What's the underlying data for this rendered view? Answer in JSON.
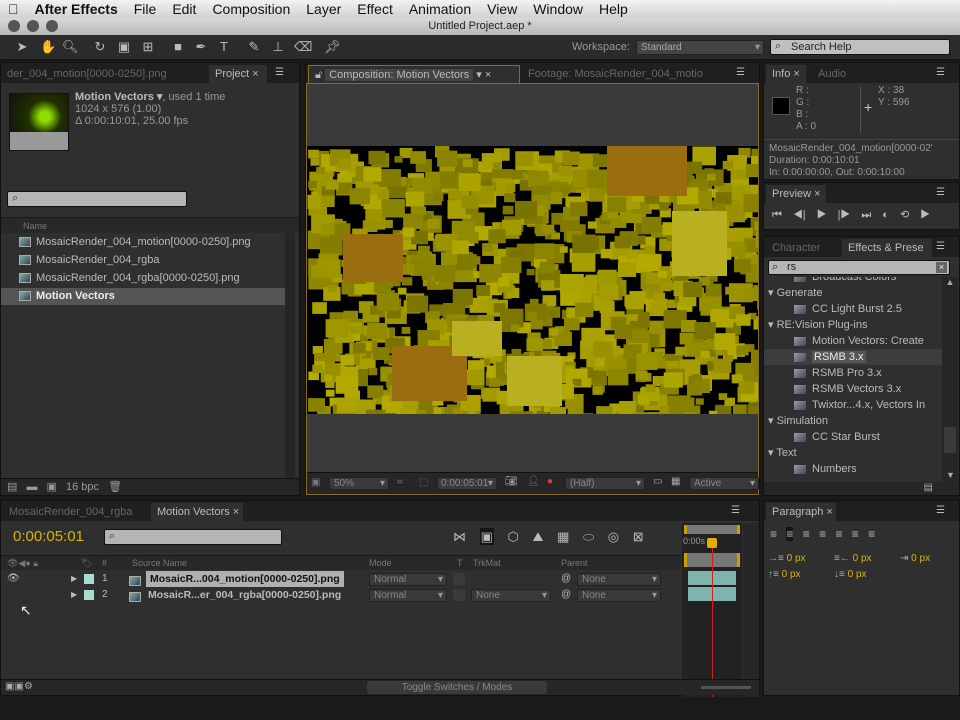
{
  "menubar": {
    "apple": "",
    "app": "After Effects",
    "items": [
      "File",
      "Edit",
      "Composition",
      "Layer",
      "Effect",
      "Animation",
      "View",
      "Window",
      "Help"
    ]
  },
  "window_title": "Untitled Project.aep *",
  "toolbar": {
    "workspace_label": "Workspace:",
    "workspace_value": "Standard",
    "search_help_placeholder": "Search Help"
  },
  "project": {
    "tabs": [
      "der_004_motion[0000-0250].png",
      "Project"
    ],
    "selected_name": "Motion Vectors ▾",
    "used": ", used 1 time",
    "dimensions": "1024 x 576 (1.00)",
    "duration": "Δ 0:00:10:01, 25.00 fps",
    "column_name": "Name",
    "items": [
      {
        "name": "MosaicRender_004_motion[0000-0250].png",
        "type": "footage"
      },
      {
        "name": "MosaicRender_004_rgba",
        "type": "comp"
      },
      {
        "name": "MosaicRender_004_rgba[0000-0250].png",
        "type": "footage"
      },
      {
        "name": "Motion Vectors",
        "type": "comp",
        "selected": true
      }
    ],
    "bpc": "16 bpc"
  },
  "composition": {
    "tabs": [
      "Composition: Motion Vectors",
      "Footage: MosaicRender_004_motio"
    ],
    "zoom": "50%",
    "timecode": "0:00:05:01",
    "resolution": "(Half)",
    "camera": "Active Camera"
  },
  "info": {
    "tabs": [
      "Info",
      "Audio"
    ],
    "r": "R :",
    "g": "G :",
    "b": "B :",
    "a": "A : 0",
    "x": "X : 38",
    "y": "Y : 596",
    "source": "MosaicRender_004_motion[0000-02'",
    "duration": "Duration: 0:00:10:01",
    "inout": "In: 0:00:00:00, Out: 0:00:10:00"
  },
  "preview": {
    "tab": "Preview"
  },
  "effects": {
    "tabs": [
      "Character",
      "Effects & Prese"
    ],
    "search": "rs",
    "items": [
      {
        "label": "Broadcast Colors",
        "level": 1
      },
      {
        "label": "Generate",
        "level": 0
      },
      {
        "label": "CC Light Burst 2.5",
        "level": 1
      },
      {
        "label": "RE:Vision Plug-ins",
        "level": 0
      },
      {
        "label": "Motion Vectors: Create",
        "level": 1
      },
      {
        "label": "RSMB 3.x",
        "level": 1,
        "selected": true
      },
      {
        "label": "RSMB Pro 3.x",
        "level": 1
      },
      {
        "label": "RSMB Vectors 3.x",
        "level": 1
      },
      {
        "label": "Twixtor...4.x, Vectors In",
        "level": 1
      },
      {
        "label": "Simulation",
        "level": 0
      },
      {
        "label": "CC Star Burst",
        "level": 1
      },
      {
        "label": "Text",
        "level": 0
      },
      {
        "label": "Numbers",
        "level": 1
      }
    ]
  },
  "timeline": {
    "tabs": [
      "MosaicRender_004_rgba",
      "Motion Vectors"
    ],
    "timecode": "0:00:05:01",
    "columns": {
      "num": "#",
      "source": "Source Name",
      "mode": "Mode",
      "t": "T",
      "trkmat": "TrkMat",
      "parent": "Parent"
    },
    "ruler_label": "0:00s",
    "layers": [
      {
        "num": "1",
        "name": "MosaicR...004_motion[0000-0250].png",
        "mode": "Normal",
        "trkmat": "",
        "parent": "None",
        "selected": true
      },
      {
        "num": "2",
        "name": "MosaicR...er_004_rgba[0000-0250].png",
        "mode": "Normal",
        "trkmat": "None",
        "parent": "None"
      }
    ],
    "toggle": "Toggle Switches / Modes",
    "playhead_fraction": 0.5
  },
  "paragraph": {
    "tab": "Paragraph",
    "values": [
      "0 px",
      "0 px",
      "0 px",
      "0 px",
      "0 px"
    ]
  },
  "colors": {
    "accent_timecode": "#d8b400",
    "comp_border": "#a08020",
    "layer_bar": "#7fb3ad",
    "playhead": "#d02020"
  }
}
